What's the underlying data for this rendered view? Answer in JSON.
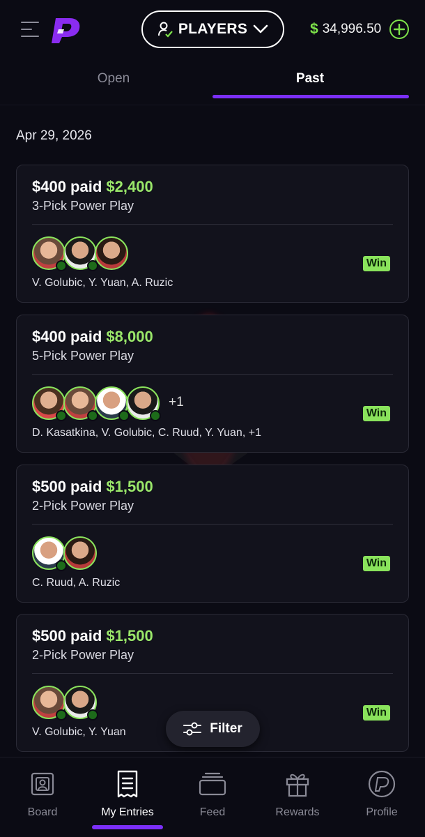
{
  "header": {
    "players_label": "PLAYERS",
    "balance_currency": "$",
    "balance_amount": "34,996.50"
  },
  "tabs": [
    {
      "label": "Open",
      "active": false
    },
    {
      "label": "Past",
      "active": true
    }
  ],
  "date": "Apr 29, 2026",
  "entries": [
    {
      "paid": "$400 paid",
      "payout": "$2,400",
      "type": "3-Pick Power Play",
      "names": "V. Golubic, Y. Yuan, A. Ruzic",
      "result": "Win",
      "extra": ""
    },
    {
      "paid": "$400 paid",
      "payout": "$8,000",
      "type": "5-Pick Power Play",
      "names": "D. Kasatkina, V. Golubic, C. Ruud, Y. Yuan, +1",
      "result": "Win",
      "extra": "+1"
    },
    {
      "paid": "$500 paid",
      "payout": "$1,500",
      "type": "2-Pick Power Play",
      "names": "C. Ruud, A. Ruzic",
      "result": "Win",
      "extra": ""
    },
    {
      "paid": "$500 paid",
      "payout": "$1,500",
      "type": "2-Pick Power Play",
      "names": "V. Golubic, Y. Yuan",
      "result": "Win",
      "extra": ""
    }
  ],
  "filter_label": "Filter",
  "nav": [
    {
      "label": "Board",
      "icon": "board-icon"
    },
    {
      "label": "My Entries",
      "icon": "entries-icon"
    },
    {
      "label": "Feed",
      "icon": "feed-icon"
    },
    {
      "label": "Rewards",
      "icon": "gift-icon"
    },
    {
      "label": "Profile",
      "icon": "profile-icon"
    }
  ],
  "colors": {
    "accent_purple": "#7b2ff7",
    "win_green": "#8ae35c",
    "payout_green": "#9ae76a",
    "background": "#0b0b14"
  }
}
